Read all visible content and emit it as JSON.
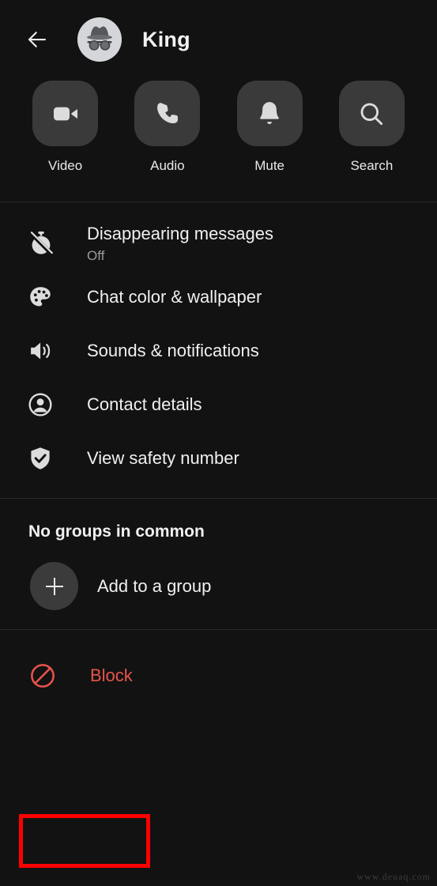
{
  "header": {
    "back_icon": "arrow-left-icon",
    "avatar_icon": "incognito-avatar",
    "title": "King"
  },
  "actions": [
    {
      "label": "Video",
      "icon": "video-camera-icon"
    },
    {
      "label": "Audio",
      "icon": "phone-icon"
    },
    {
      "label": "Mute",
      "icon": "bell-icon"
    },
    {
      "label": "Search",
      "icon": "search-icon"
    }
  ],
  "settings": [
    {
      "title": "Disappearing messages",
      "subtitle": "Off",
      "icon": "timer-off-icon"
    },
    {
      "title": "Chat color & wallpaper",
      "subtitle": "",
      "icon": "palette-icon"
    },
    {
      "title": "Sounds & notifications",
      "subtitle": "",
      "icon": "speaker-icon"
    },
    {
      "title": "Contact details",
      "subtitle": "",
      "icon": "person-circle-icon"
    },
    {
      "title": "View safety number",
      "subtitle": "",
      "icon": "shield-check-icon"
    }
  ],
  "groups": {
    "header": "No groups in common",
    "add_label": "Add to a group",
    "add_icon": "plus-icon"
  },
  "block": {
    "label": "Block",
    "icon": "block-circle-slash-icon"
  },
  "watermark": "www.deuaq.com",
  "colors": {
    "background": "#121212",
    "tile": "#3a3a3a",
    "text_primary": "#f0f0f0",
    "text_secondary": "#9b9b9b",
    "danger": "#e8544b",
    "annotation": "#fd0000"
  }
}
